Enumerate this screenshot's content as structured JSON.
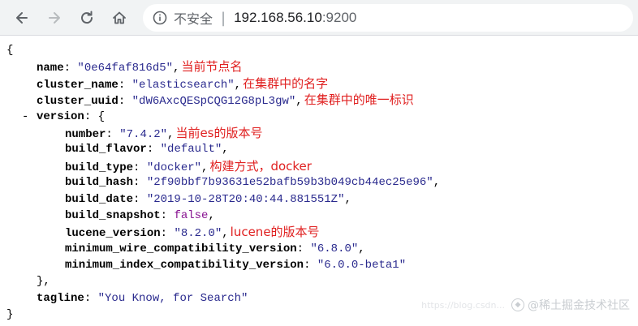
{
  "browser": {
    "security_label": "不安全",
    "url_host": "192.168.56.10",
    "url_port": ":9200",
    "icons": [
      "back-arrow-icon",
      "forward-arrow-icon",
      "reload-icon",
      "home-icon",
      "info-circle-icon"
    ]
  },
  "response": {
    "open_brace": "{",
    "close_brace": "}",
    "name": {
      "key": "name",
      "value": "\"0e64faf816d5\"",
      "note": "当前节点名"
    },
    "cluster_name": {
      "key": "cluster_name",
      "value": "\"elasticsearch\"",
      "note": "在集群中的名字"
    },
    "cluster_uuid": {
      "key": "cluster_uuid",
      "value": "\"dW6AxcQESpCQG12G8pL3gw\"",
      "note": "在集群中的唯一标识"
    },
    "version": {
      "key": "version",
      "toggle": "-",
      "open": "{",
      "close": "},",
      "number": {
        "key": "number",
        "value": "\"7.4.2\"",
        "note": "当前es的版本号"
      },
      "build_flavor": {
        "key": "build_flavor",
        "value": "\"default\""
      },
      "build_type": {
        "key": "build_type",
        "value": "\"docker\"",
        "note": "构建方式，docker"
      },
      "build_hash": {
        "key": "build_hash",
        "value": "\"2f90bbf7b93631e52bafb59b3b049cb44ec25e96\""
      },
      "build_date": {
        "key": "build_date",
        "value": "\"2019-10-28T20:40:44.881551Z\""
      },
      "build_snapshot": {
        "key": "build_snapshot",
        "value": "false"
      },
      "lucene_version": {
        "key": "lucene_version",
        "value": "\"8.2.0\"",
        "note": "lucene的版本号"
      },
      "minimum_wire_compatibility_version": {
        "key": "minimum_wire_compatibility_version",
        "value": "\"6.8.0\""
      },
      "minimum_index_compatibility_version": {
        "key": "minimum_index_compatibility_version",
        "value": "\"6.0.0-beta1\""
      }
    },
    "tagline": {
      "key": "tagline",
      "value": "\"You Know, for Search\""
    }
  },
  "watermark": {
    "faint": "https://blog.csdn...",
    "text": "@稀土掘金技术社区"
  }
}
